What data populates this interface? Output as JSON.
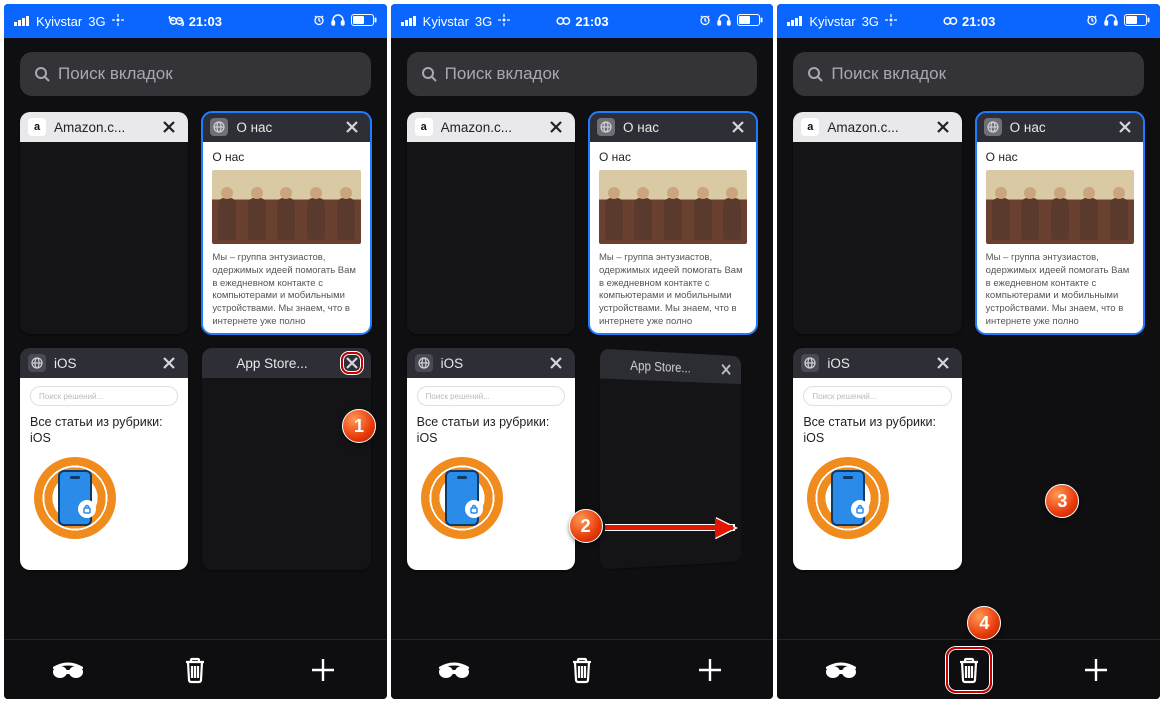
{
  "status": {
    "carrier": "Kyivstar",
    "network": "3G",
    "time": "21:03"
  },
  "search": {
    "placeholder": "Поиск вкладок"
  },
  "tabs": {
    "amazon": {
      "title": "Amazon.c..."
    },
    "onas": {
      "title": "О нас",
      "heading": "О нас",
      "blurb": "Мы – группа энтузиастов, одержимых идеей помогать Вам в ежедневном контакте с компьютерами и мобильными устройствами. Мы знаем, что в интернете уже полно"
    },
    "ios": {
      "title": "iOS",
      "inner_search_placeholder": "Поиск решений...",
      "heading": "Все статьи из рубрики: iOS"
    },
    "appstore": {
      "title": "App Store..."
    }
  },
  "steps": {
    "one": "1",
    "two": "2",
    "three": "3",
    "four": "4"
  },
  "icons": {
    "incognito": "incognito",
    "trash": "trash",
    "add": "+"
  }
}
